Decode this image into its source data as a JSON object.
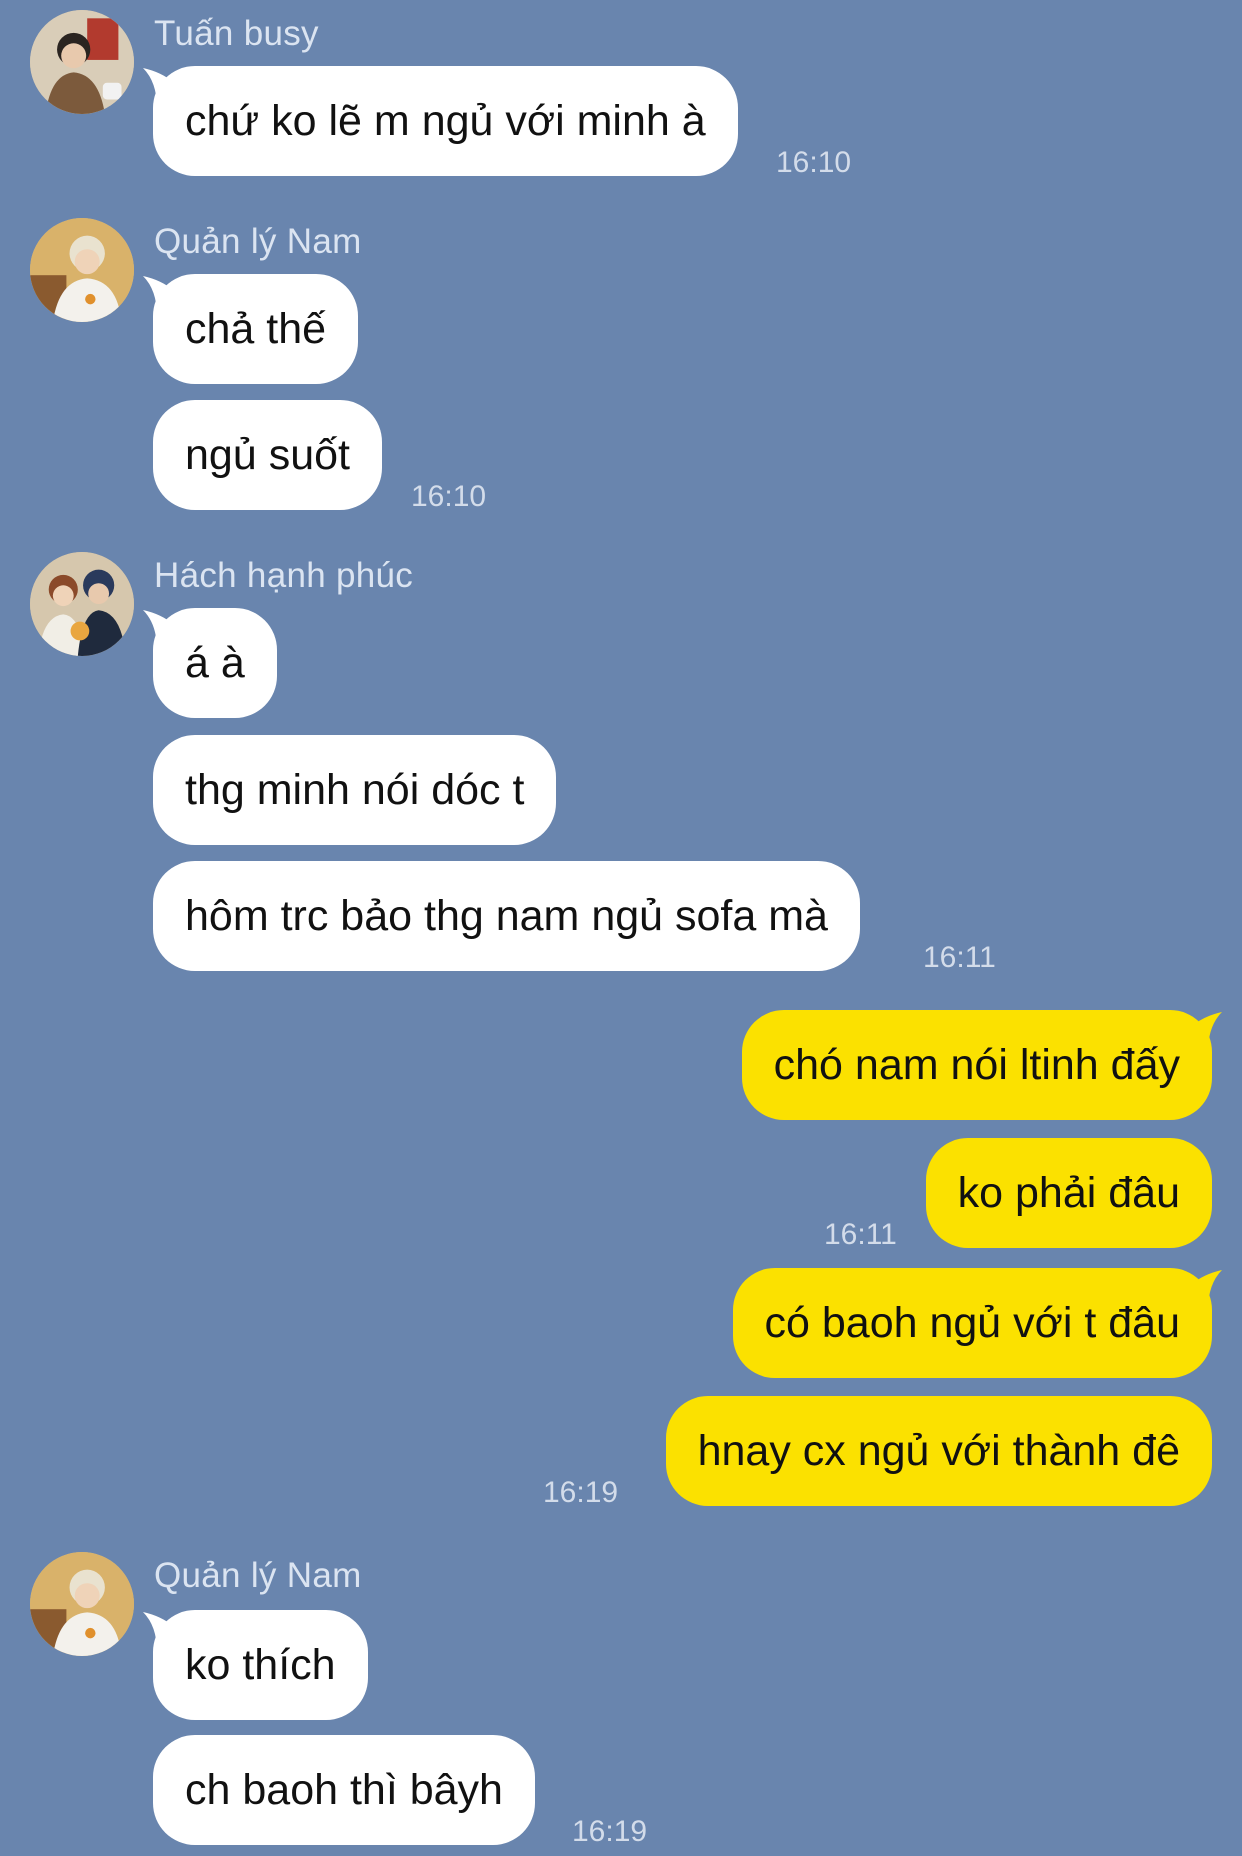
{
  "chat": {
    "groups": [
      {
        "sender": "Tuấn busy",
        "avatar": "person-avatar",
        "messages": [
          "chứ ko lẽ m ngủ với minh à"
        ],
        "time": "16:10"
      },
      {
        "sender": "Quản lý Nam",
        "avatar": "person-avatar",
        "messages": [
          "chả thế",
          "ngủ suốt"
        ],
        "time": "16:10"
      },
      {
        "sender": "Hách hạnh phúc",
        "avatar": "couple-avatar",
        "messages": [
          "á à",
          "thg minh nói dóc t",
          "hôm trc bảo thg nam ngủ sofa mà"
        ],
        "time": "16:11"
      }
    ],
    "outgoing": [
      {
        "messages": [
          "chó nam nói ltinh đấy",
          "ko phải đâu"
        ],
        "time": "16:11"
      },
      {
        "messages": [
          "có baoh ngủ với t đâu",
          "hnay cx ngủ với thành đê"
        ],
        "time": "16:19"
      }
    ],
    "last_group": {
      "sender": "Quản lý Nam",
      "avatar": "person-avatar",
      "messages": [
        "ko thích",
        "ch baoh thì bâyh"
      ],
      "time": "16:19"
    },
    "colors": {
      "background": "#6985ae",
      "incoming_bubble": "#ffffff",
      "outgoing_bubble": "#fbe100"
    }
  }
}
